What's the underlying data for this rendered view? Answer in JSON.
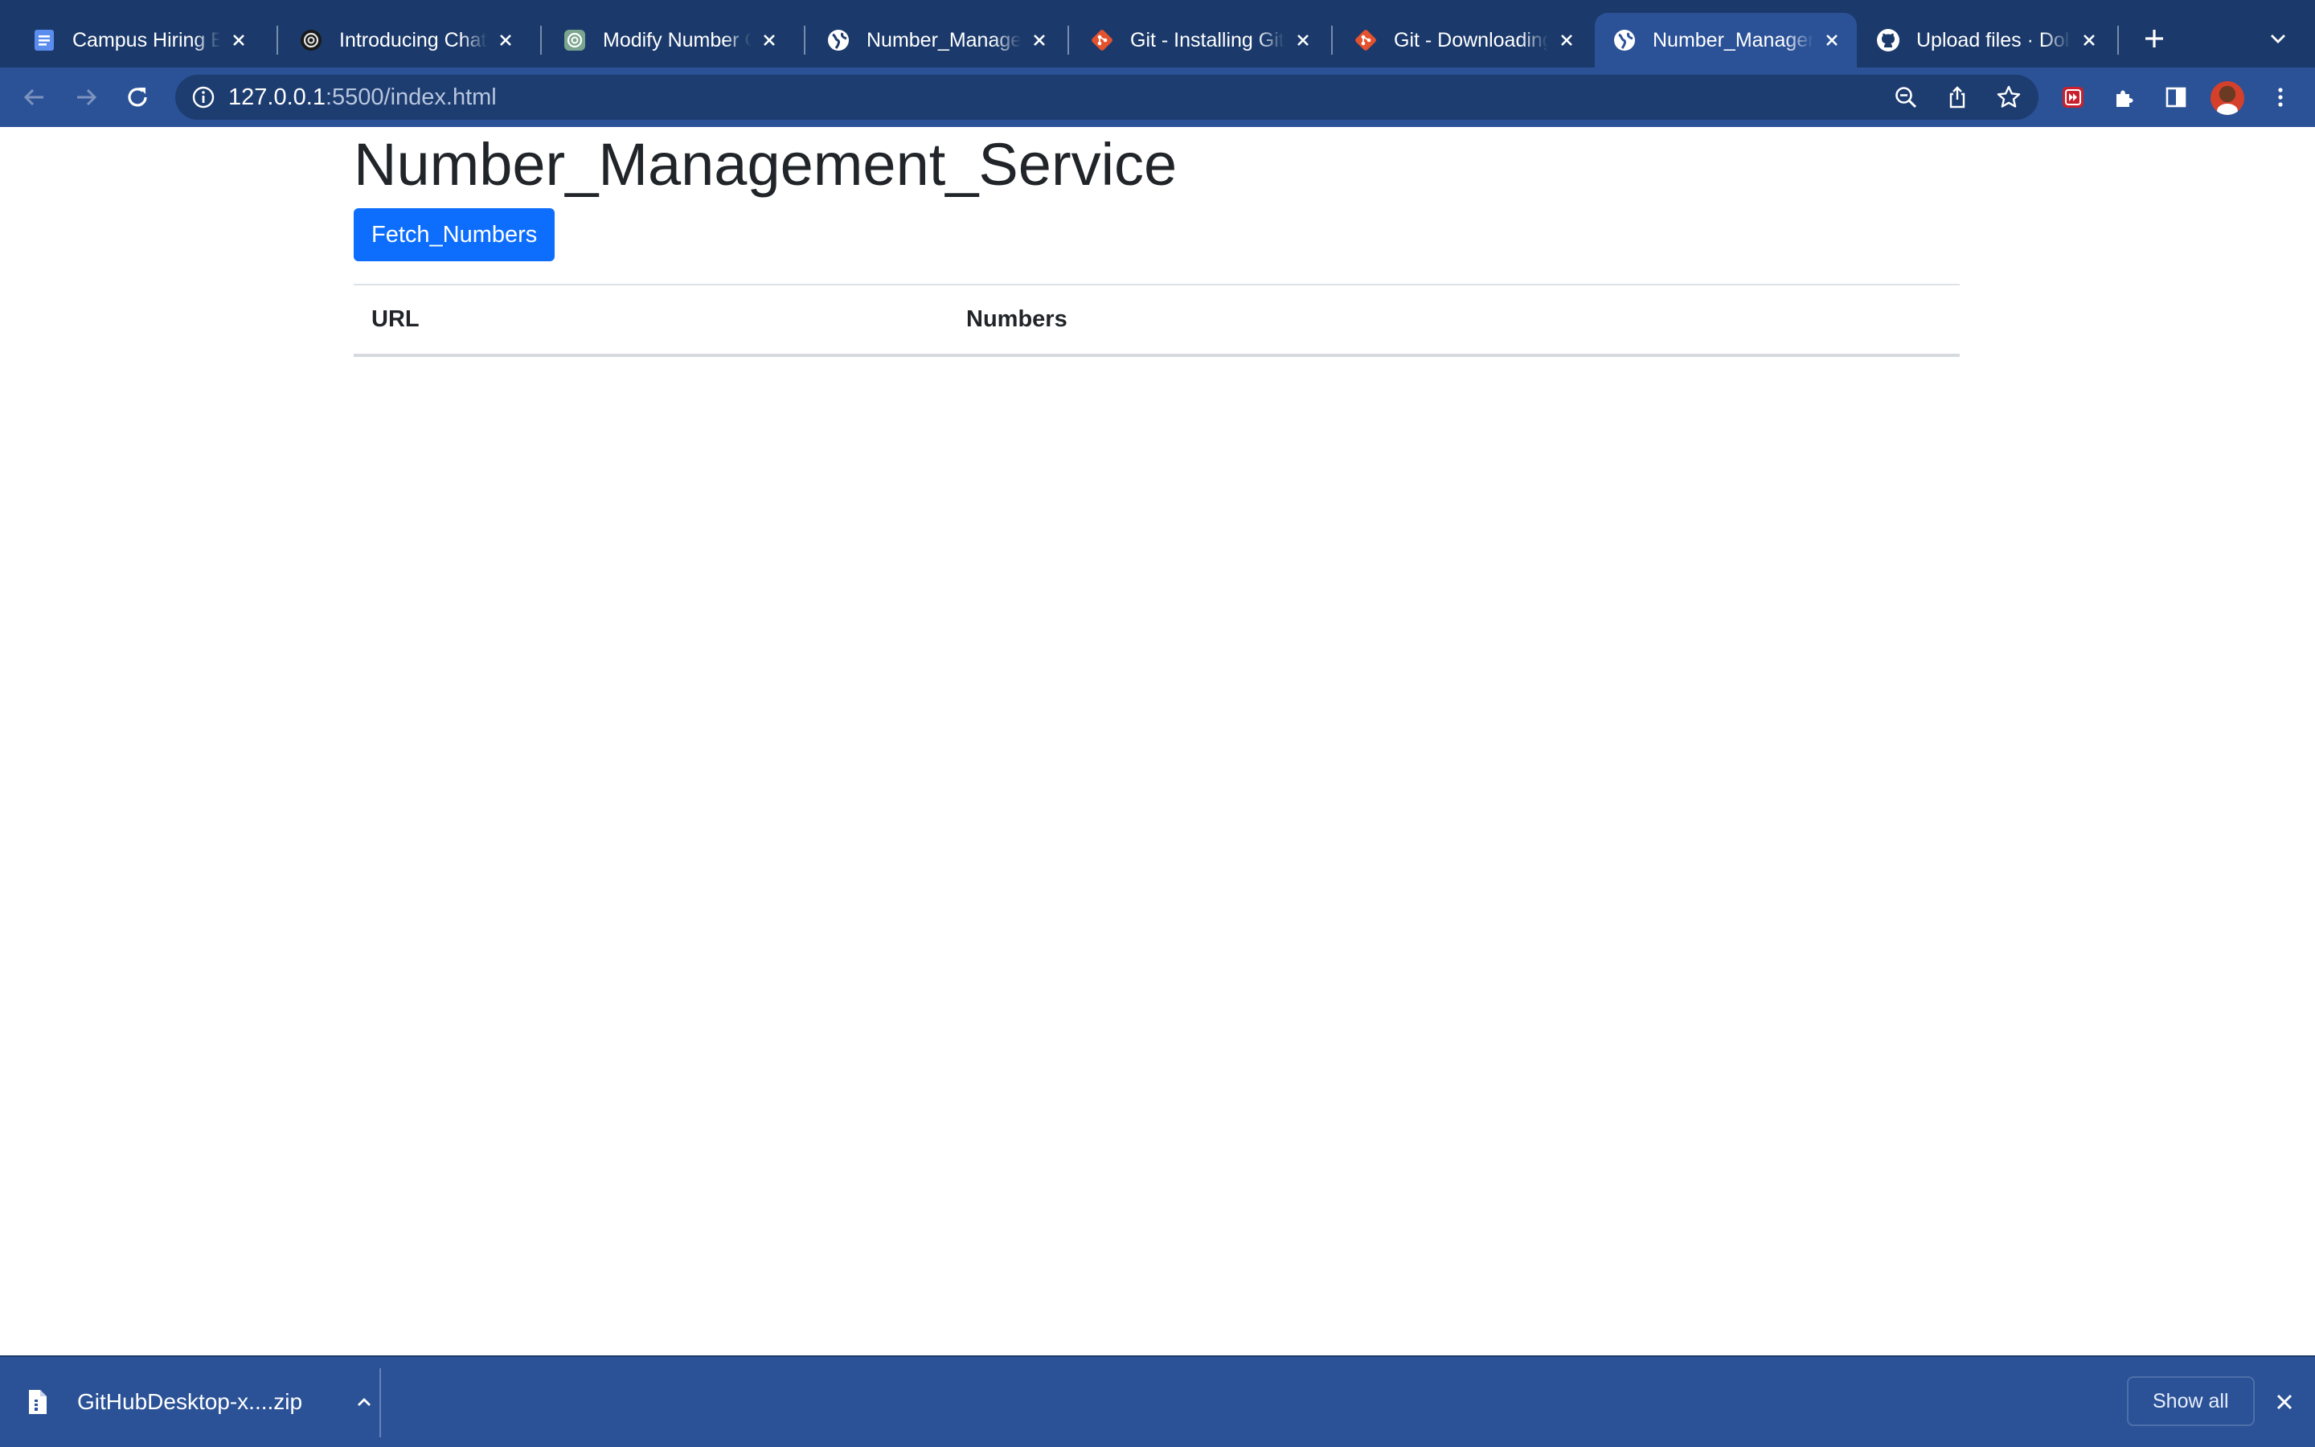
{
  "browser": {
    "tabs": [
      {
        "title": "Campus Hiring Ev",
        "favicon": "google-docs-icon",
        "active": false
      },
      {
        "title": "Introducing ChatG",
        "favicon": "openai-icon",
        "active": false
      },
      {
        "title": "Modify Number C",
        "favicon": "chatgpt-icon",
        "active": false
      },
      {
        "title": "Number_Manager",
        "favicon": "globe-icon",
        "active": false
      },
      {
        "title": "Git - Installing Git",
        "favicon": "git-icon",
        "active": false
      },
      {
        "title": "Git - Downloading",
        "favicon": "git-icon",
        "active": false
      },
      {
        "title": "Number_Manager",
        "favicon": "globe-icon",
        "active": true
      },
      {
        "title": "Upload files · Doll",
        "favicon": "github-icon",
        "active": false
      }
    ],
    "address": {
      "host": "127.0.0.1",
      "rest": ":5500/index.html"
    }
  },
  "page": {
    "title": "Number_Management_Service",
    "fetch_button": "Fetch_Numbers",
    "table": {
      "headers": [
        "URL",
        "Numbers"
      ],
      "rows": []
    }
  },
  "downloads": {
    "file_name": "GitHubDesktop-x....zip",
    "show_all": "Show all"
  },
  "colors": {
    "tabstrip": "#1b3a6b",
    "toolbar": "#2b5297",
    "primary_button": "#0d6efd",
    "text": "#212529"
  }
}
